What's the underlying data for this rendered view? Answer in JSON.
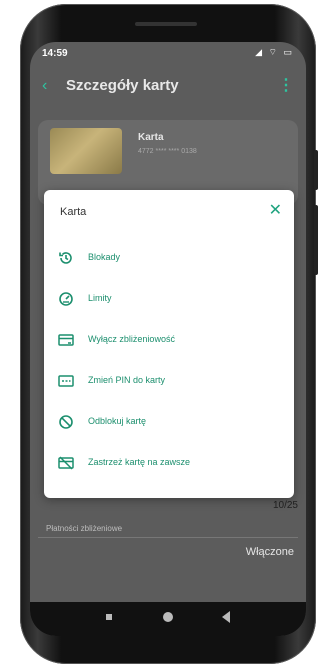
{
  "status_bar": {
    "time": "14:59",
    "icons": "◢ ⌔ ▭"
  },
  "header": {
    "back_icon": "‹",
    "title": "Szczegóły karty",
    "more_icon": "⋮"
  },
  "card": {
    "title": "Karta",
    "number": "4772 **** **** 0138"
  },
  "background": {
    "date_value": "10/25",
    "contactless_label": "Płatności zbliżeniowe",
    "contactless_value": "Włączone"
  },
  "dialog": {
    "title": "Karta",
    "close_icon": "✕",
    "items": [
      {
        "label": "Blokady",
        "icon": "history-icon"
      },
      {
        "label": "Limity",
        "icon": "gauge-icon"
      },
      {
        "label": "Wyłącz zbliżeniowość",
        "icon": "card-contactless-icon"
      },
      {
        "label": "Zmień PIN do karty",
        "icon": "pin-card-icon"
      },
      {
        "label": "Odblokuj kartę",
        "icon": "block-icon"
      },
      {
        "label": "Zastrzeż kartę na zawsze",
        "icon": "card-cancel-icon"
      }
    ]
  },
  "colors": {
    "accent": "#1c8f6e",
    "overlay": "#5c5c5c",
    "dialog_bg": "#ffffff"
  }
}
